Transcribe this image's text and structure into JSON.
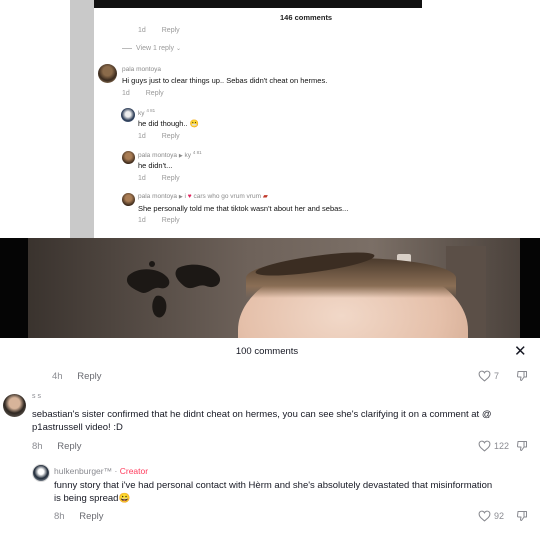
{
  "top_screenshot": {
    "comments_count": "146 comments",
    "first_meta": {
      "age": "1d",
      "reply": "Reply"
    },
    "view_replies": "View 1 reply",
    "comments": [
      {
        "user": "pala montoya",
        "text": "Hi guys just to clear things up.. Sebas didn't cheat on hermes.",
        "age": "1d",
        "reply": "Reply"
      },
      {
        "user": "ky",
        "user_tag": "4 81",
        "text": "he did though..",
        "emoji": "😬",
        "age": "1d",
        "reply": "Reply"
      },
      {
        "user": "pala montoya",
        "reply_to": "ky",
        "reply_to_tag": "4 81",
        "text": "he didn't...",
        "age": "1d",
        "reply": "Reply"
      },
      {
        "user": "pala montoya",
        "reply_to_prefix": "i",
        "reply_to": "cars who go vrum vrum",
        "text": "She personally told me that tiktok wasn't about her and sebas...",
        "age": "1d",
        "reply": "Reply"
      }
    ]
  },
  "bottom_screenshot": {
    "comments_count": "100 comments",
    "close_icon": "close-icon",
    "first_meta": {
      "age": "4h",
      "reply": "Reply",
      "likes": "7"
    },
    "comments": [
      {
        "user": "s s",
        "text": "sebastian's sister confirmed that he didnt cheat on hermes, you can see she's clarifying it on a comment at @ p1astrussell video! :D",
        "age": "8h",
        "reply": "Reply",
        "likes": "122"
      },
      {
        "user": "hulkenburger™",
        "badge": "Creator",
        "text": "funny story that i've had personal contact with Hèrm and she's absolutely devastated that misinformation is being spread",
        "emoji": "😀",
        "age": "8h",
        "reply": "Reply",
        "likes": "92"
      }
    ]
  },
  "colors": {
    "creator": "#ff3b5c",
    "muted": "#8a8b91",
    "text": "#161823"
  }
}
